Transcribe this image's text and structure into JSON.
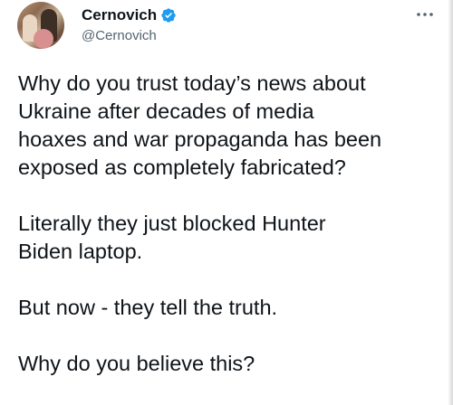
{
  "author": {
    "display_name": "Cernovich",
    "handle": "@Cernovich",
    "verified": true,
    "avatar_icon": "profile-photo"
  },
  "menu": {
    "icon": "more-horizontal-icon"
  },
  "tweet": {
    "paragraphs": [
      [
        "Why do you trust today’s news about",
        "Ukraine after decades of media",
        "hoaxes and war propaganda has been",
        "exposed as completely fabricated?"
      ],
      [
        "Literally they just blocked Hunter",
        "Biden laptop."
      ],
      [
        "But now - they tell the truth."
      ],
      [
        "Why do you believe this?"
      ]
    ]
  },
  "colors": {
    "text": "#0f1419",
    "secondary": "#536471",
    "verified_blue": "#1d9bf0"
  }
}
